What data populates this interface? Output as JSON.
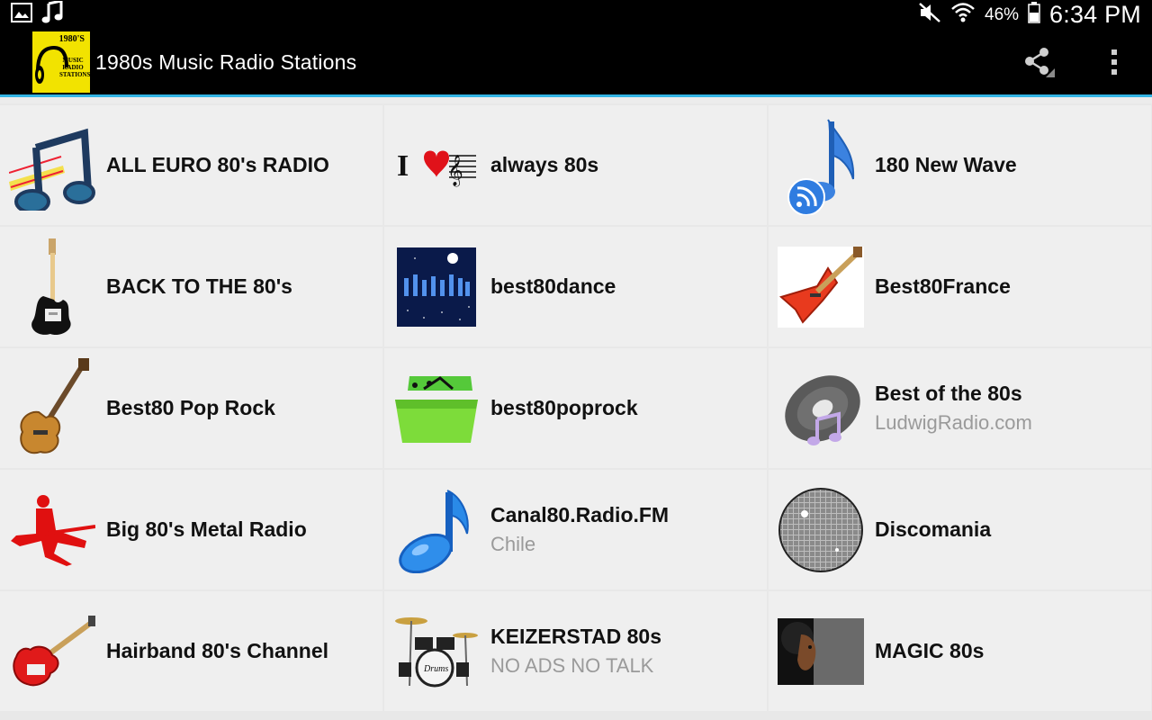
{
  "status_bar": {
    "battery_text": "46%",
    "time": "6:34 PM"
  },
  "action_bar": {
    "title": "1980s Music Radio Stations",
    "icon_text_top": "1980'S",
    "icon_text_mid": "MUSIC RADIO STATIONS"
  },
  "stations": [
    {
      "name": "ALL EURO 80's RADIO",
      "sub": "",
      "icon": "music-notes-icon"
    },
    {
      "name": "always 80s",
      "sub": "",
      "icon": "i-love-music-icon"
    },
    {
      "name": "180 New Wave",
      "sub": "",
      "icon": "blue-note-rss-icon"
    },
    {
      "name": "BACK TO THE 80's",
      "sub": "",
      "icon": "electric-guitar-icon"
    },
    {
      "name": "best80dance",
      "sub": "",
      "icon": "dance-crowd-icon"
    },
    {
      "name": "Best80France",
      "sub": "",
      "icon": "red-guitar-icon"
    },
    {
      "name": "Best80 Pop Rock",
      "sub": "",
      "icon": "acoustic-guitar-icon"
    },
    {
      "name": "best80poprock",
      "sub": "",
      "icon": "green-folder-icon"
    },
    {
      "name": "Best of the 80s",
      "sub": "LudwigRadio.com",
      "icon": "vinyl-record-icon"
    },
    {
      "name": "Big 80's Metal Radio",
      "sub": "",
      "icon": "guitarist-silhouette-icon"
    },
    {
      "name": "Canal80.Radio.FM",
      "sub": "Chile",
      "icon": "blue-music-note-icon"
    },
    {
      "name": "Discomania",
      "sub": "",
      "icon": "disco-ball-icon"
    },
    {
      "name": "Hairband 80's Channel",
      "sub": "",
      "icon": "red-electric-guitar-icon"
    },
    {
      "name": "KEIZERSTAD 80s",
      "sub": "NO ADS NO TALK",
      "icon": "drum-kit-icon"
    },
    {
      "name": "MAGIC 80s",
      "sub": "",
      "icon": "portrait-icon"
    }
  ]
}
